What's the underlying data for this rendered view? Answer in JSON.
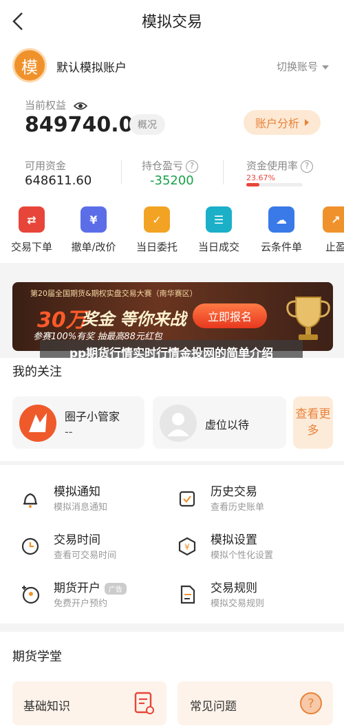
{
  "header": {
    "title": "模拟交易"
  },
  "account": {
    "avatar_char": "模",
    "name": "默认模拟账户",
    "switch_label": "切换账号",
    "equity_label": "当前权益",
    "equity_value": "849740.00",
    "badge": "概况",
    "analysis_label": "账户分析",
    "available_label": "可用资金",
    "available_value": "648611.60",
    "pnl_label": "持仓盈亏",
    "pnl_value": "-35200",
    "usage_label": "资金使用率",
    "usage_value": "23.67%",
    "usage_fraction": 0.2367,
    "colors": {
      "accent": "#e8833a",
      "loss_green": "#1aa04a",
      "usage_red": "#e8453a"
    }
  },
  "quick_actions": [
    {
      "label": "交易下单",
      "icon": "trade-order-icon",
      "color": "#e8453a"
    },
    {
      "label": "撤单/改价",
      "icon": "cancel-order-icon",
      "color": "#5b6ee8"
    },
    {
      "label": "当日委托",
      "icon": "daily-entrust-icon",
      "color": "#f2a324"
    },
    {
      "label": "当日成交",
      "icon": "daily-deal-icon",
      "color": "#1bb0c8"
    },
    {
      "label": "云条件单",
      "icon": "cloud-condition-icon",
      "color": "#3a7ae8"
    },
    {
      "label": "止盈",
      "icon": "take-profit-icon",
      "color": "#f0922c"
    }
  ],
  "banner": {
    "top_line": "第20届全国期货&期权实盘交易大赛（南华赛区）",
    "money": "30万",
    "headline": "奖金 等你来战",
    "sub_line": "参赛100%有奖 抽最高88元红包",
    "button": "立即报名"
  },
  "overlay": {
    "text": "pp期货行情实时行情金投网的简单介绍"
  },
  "follow": {
    "title": "我的关注",
    "items": [
      {
        "name": "圈子小管家",
        "sub": "--"
      },
      {
        "name": "虚位以待",
        "sub": ""
      }
    ],
    "more": "查看更多"
  },
  "menu": [
    {
      "title": "模拟通知",
      "sub": "模拟消息通知",
      "icon": "bell-icon"
    },
    {
      "title": "历史交易",
      "sub": "查看历史账单",
      "icon": "history-icon"
    },
    {
      "title": "交易时间",
      "sub": "查看可交易时间",
      "icon": "clock-icon"
    },
    {
      "title": "模拟设置",
      "sub": "模拟个性化设置",
      "icon": "settings-icon"
    },
    {
      "title": "期货开户",
      "sub": "免费开户预约",
      "icon": "account-open-icon",
      "tag": "广告"
    },
    {
      "title": "交易规则",
      "sub": "模拟交易规则",
      "icon": "rules-icon"
    }
  ],
  "school": {
    "title": "期货学堂",
    "items": [
      {
        "label": "基础知识",
        "icon": "document-icon"
      },
      {
        "label": "常见问题",
        "icon": "question-icon"
      }
    ]
  }
}
